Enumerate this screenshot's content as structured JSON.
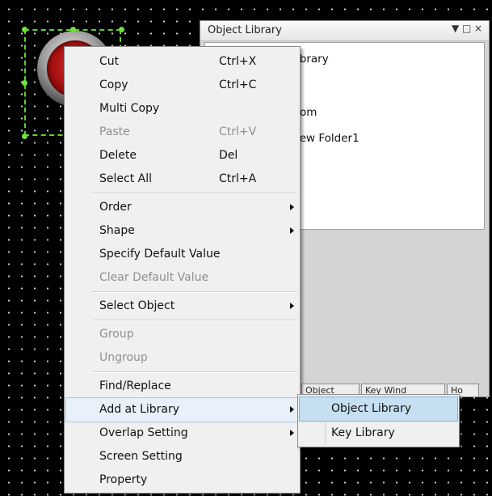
{
  "panel": {
    "title": "Object Library",
    "controls": [
      "▼",
      "□",
      "×"
    ],
    "tree": [
      {
        "text": "ibrary"
      },
      {
        "text": "om"
      },
      {
        "text": "lew Folder1"
      }
    ],
    "tabs": [
      "Object",
      "Key Wind",
      "Ho"
    ]
  },
  "menu": {
    "cut": {
      "label": "Cut",
      "shortcut": "Ctrl+X"
    },
    "copy": {
      "label": "Copy",
      "shortcut": "Ctrl+C"
    },
    "multi_copy": {
      "label": "Multi Copy"
    },
    "paste": {
      "label": "Paste",
      "shortcut": "Ctrl+V"
    },
    "delete": {
      "label": "Delete",
      "shortcut": "Del"
    },
    "select_all": {
      "label": "Select All",
      "shortcut": "Ctrl+A"
    },
    "order": {
      "label": "Order"
    },
    "shape": {
      "label": "Shape"
    },
    "specify_default": {
      "label": "Specify Default Value"
    },
    "clear_default": {
      "label": "Clear Default Value"
    },
    "select_object": {
      "label": "Select Object"
    },
    "group": {
      "label": "Group"
    },
    "ungroup": {
      "label": "Ungroup"
    },
    "find_replace": {
      "label": "Find/Replace"
    },
    "add_at_library": {
      "label": "Add at Library"
    },
    "overlap_setting": {
      "label": "Overlap Setting"
    },
    "screen_setting": {
      "label": "Screen Setting"
    },
    "property": {
      "label": "Property"
    }
  },
  "submenu": {
    "object_library": {
      "label": "Object Library"
    },
    "key_library": {
      "label": "Key Library"
    }
  }
}
